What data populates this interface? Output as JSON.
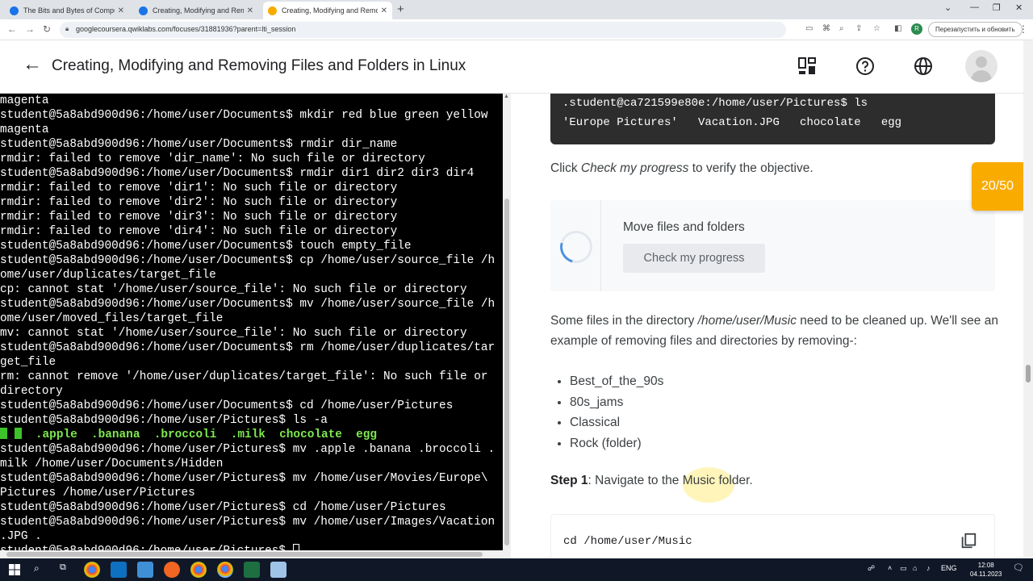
{
  "browser": {
    "tabs": [
      {
        "title": "The Bits and Bytes of Computer",
        "favicon_color": "#1a73e8",
        "active": false
      },
      {
        "title": "Creating, Modifying and Remov",
        "favicon_color": "#1a73e8",
        "active": false
      },
      {
        "title": "Creating, Modifying and Remov",
        "favicon_color": "#f9ab00",
        "active": true
      }
    ],
    "url": "googlecoursera.qwiklabs.com/focuses/31881936?parent=lti_session",
    "profile_initial": "R",
    "relaunch_label": "Перезапустить и обновить"
  },
  "header": {
    "title": "Creating, Modifying and Removing Files and Folders in Linux"
  },
  "terminal": {
    "lines": [
      "magenta",
      "student@5a8abd900d96:/home/user/Documents$ mkdir red blue green yellow",
      "magenta",
      "student@5a8abd900d96:/home/user/Documents$ rmdir dir_name",
      "rmdir: failed to remove 'dir_name': No such file or directory",
      "student@5a8abd900d96:/home/user/Documents$ rmdir dir1 dir2 dir3 dir4",
      "rmdir: failed to remove 'dir1': No such file or directory",
      "rmdir: failed to remove 'dir2': No such file or directory",
      "rmdir: failed to remove 'dir3': No such file or directory",
      "rmdir: failed to remove 'dir4': No such file or directory",
      "student@5a8abd900d96:/home/user/Documents$ touch empty_file",
      "student@5a8abd900d96:/home/user/Documents$ cp /home/user/source_file /h",
      "ome/user/duplicates/target_file",
      "cp: cannot stat '/home/user/source_file': No such file or directory",
      "student@5a8abd900d96:/home/user/Documents$ mv /home/user/source_file /h",
      "ome/user/moved_files/target_file",
      "mv: cannot stat '/home/user/source_file': No such file or directory",
      "student@5a8abd900d96:/home/user/Documents$ rm /home/user/duplicates/tar",
      "get_file",
      "rm: cannot remove '/home/user/duplicates/target_file': No such file or",
      "directory",
      "student@5a8abd900d96:/home/user/Documents$ cd /home/user/Pictures",
      "student@5a8abd900d96:/home/user/Pictures$ ls -a"
    ],
    "ls_output": "      .apple  .banana  .broccoli  .milk  chocolate  egg",
    "lines_after": [
      "student@5a8abd900d96:/home/user/Pictures$ mv .apple .banana .broccoli .",
      "milk /home/user/Documents/Hidden",
      "student@5a8abd900d96:/home/user/Pictures$ mv /home/user/Movies/Europe\\",
      "Pictures /home/user/Pictures",
      "student@5a8abd900d96:/home/user/Pictures$ cd /home/user/Pictures",
      "student@5a8abd900d96:/home/user/Pictures$ mv /home/user/Images/Vacation",
      ".JPG .",
      "student@5a8abd900d96:/home/user/Pictures$ "
    ]
  },
  "instructions": {
    "code_top": [
      ".student@ca721599e80e:/home/user/Pictures$ ls",
      "'Europe Pictures'   Vacation.JPG   chocolate   egg"
    ],
    "click_prefix": "Click ",
    "click_em": "Check my progress",
    "click_suffix": " to verify the objective.",
    "progress_card_title": "Move files and folders",
    "check_button": "Check my progress",
    "para_prefix": "Some files in the directory ",
    "para_em": "/home/user/Music",
    "para_suffix": " need to be cleaned up. We'll see an example of removing files and directories by removing-:",
    "bullets": [
      "Best_of_the_90s",
      "80s_jams",
      "Classical",
      "Rock (folder)"
    ],
    "step_label": "Step 1",
    "step_text": ": Navigate to the Music folder.",
    "code_bottom": "cd /home/user/Music"
  },
  "score": "20/50",
  "taskbar": {
    "language": "ENG",
    "time": "12:08",
    "date": "04.11.2023"
  }
}
